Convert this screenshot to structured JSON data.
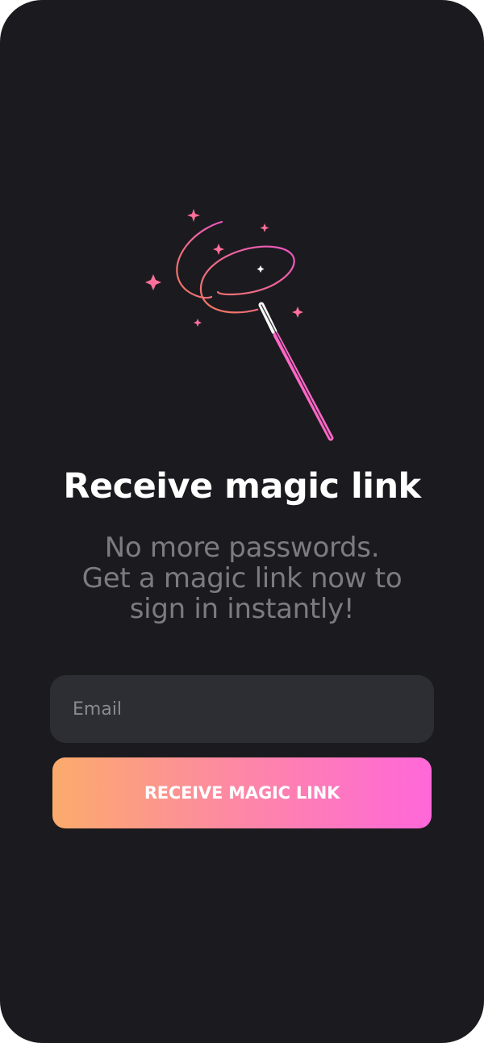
{
  "screen": {
    "title": "Receive magic link",
    "subtitle_lines": [
      "No more passwords.",
      "Get a magic link now to",
      "sign in instantly!"
    ]
  },
  "form": {
    "email_placeholder": "Email",
    "email_value": "",
    "submit_label": "RECEIVE MAGIC LINK"
  },
  "illustration": {
    "icon": "magic-wand-icon"
  },
  "colors": {
    "background": "#1b1b1f",
    "input_background": "#2d2e34",
    "title": "#ffffff",
    "subtitle": "#7b7b80",
    "gradient_start": "#fbab6c",
    "gradient_end": "#ff67d9",
    "wand": "#ff67c8",
    "sparkle": "#ff6f9a"
  }
}
